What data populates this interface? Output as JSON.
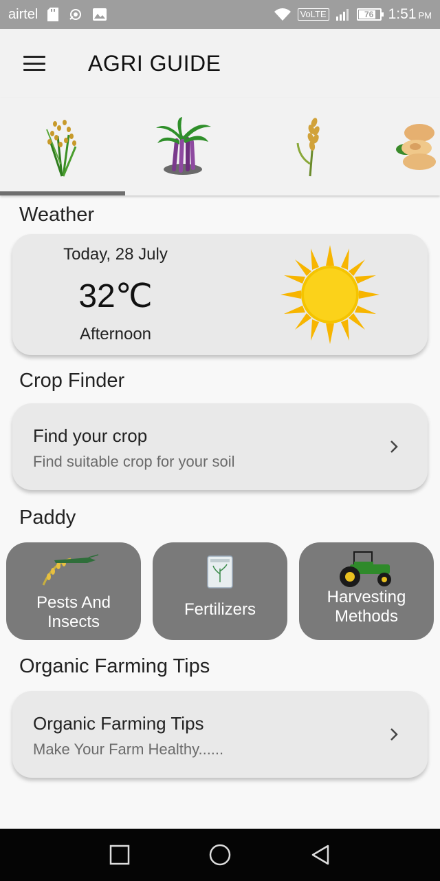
{
  "status_bar": {
    "carrier": "airtel",
    "network": "VoLTE",
    "battery": "76",
    "time": "1:51",
    "ampm": "PM"
  },
  "app_bar": {
    "title": "AGRI GUIDE"
  },
  "crop_tabs": [
    "paddy-icon",
    "sugarcane-icon",
    "wheat-icon",
    "groundnut-icon"
  ],
  "weather": {
    "heading": "Weather",
    "date": "Today, 28 July",
    "temperature": "32℃",
    "period": "Afternoon"
  },
  "crop_finder": {
    "heading": "Crop Finder",
    "title": "Find your crop",
    "subtitle": "Find suitable crop for your soil"
  },
  "paddy": {
    "heading": "Paddy",
    "tiles": [
      {
        "label_line1": "Pests And",
        "label_line2": "Insects"
      },
      {
        "label_line1": "Fertilizers"
      },
      {
        "label_line1": "Harvesting",
        "label_line2": "Methods"
      }
    ]
  },
  "organic": {
    "heading": "Organic Farming Tips",
    "title": "Organic Farming Tips",
    "subtitle": "Make Your Farm Healthy......"
  },
  "colors": {
    "tile_bg": "#7a7a7a",
    "card_bg": "#e9e9e9",
    "sun": "#f7c600"
  }
}
